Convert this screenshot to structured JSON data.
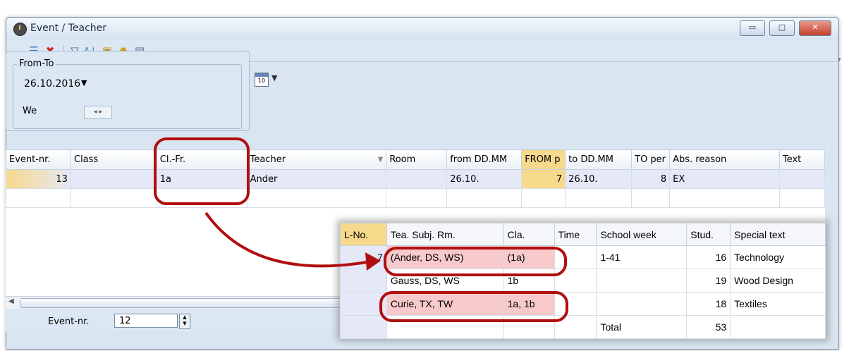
{
  "window": {
    "title": "Event / Teacher",
    "buttons": {
      "minimize": "▭",
      "maximize": "□",
      "close": "✕"
    }
  },
  "toolbar": {
    "icons": [
      "list-icon",
      "delete-icon",
      "filter-icon",
      "sort-icon",
      "settings-page-icon",
      "gear-icon",
      "clipboard-icon"
    ]
  },
  "filter": {
    "group_label": "From-To",
    "date_value": "26.10.2016",
    "weekday": "We",
    "calendar_icon_text": "10"
  },
  "grid": {
    "columns": [
      "Event-nr.",
      "Class",
      "Cl.-Fr.",
      "Teacher",
      "Room",
      "from DD.MM",
      "FROM p",
      "to DD.MM",
      "TO per",
      "Abs. reason",
      "Text"
    ],
    "row": {
      "event_nr": "13",
      "class": "",
      "cl_fr": "1a",
      "teacher": "Ander",
      "room": "",
      "from_ddmm": "26.10.",
      "from_p": "7",
      "to_ddmm": "26.10.",
      "to_per": "8",
      "abs_reason": "EX",
      "text": ""
    }
  },
  "footer": {
    "label": "Event-nr.",
    "value": "12"
  },
  "popup": {
    "columns": [
      "L-No.",
      "Tea. Subj. Rm.",
      "Cla.",
      "Time",
      "School week",
      "Stud.",
      "Special text"
    ],
    "rows": [
      {
        "lno": "7",
        "tea": "(Ander, DS, WS)",
        "cla": "(1a)",
        "time": "",
        "week": "1-41",
        "stud": "16",
        "special": "Technology"
      },
      {
        "lno": "",
        "tea": "Gauss, DS, WS",
        "cla": "1b",
        "time": "",
        "week": "",
        "stud": "19",
        "special": "Wood Design"
      },
      {
        "lno": "",
        "tea": "Curie, TX, TW",
        "cla": "1a, 1b",
        "time": "",
        "week": "",
        "stud": "18",
        "special": "Textiles"
      },
      {
        "lno": "",
        "tea": "",
        "cla": "",
        "time": "",
        "week": "Total",
        "stud": "53",
        "special": ""
      }
    ]
  },
  "colors": {
    "highlight_header": "#f7d98b",
    "selected_row": "#e5e8f7",
    "annotation_red": "#b10f0f",
    "pink_cell": "#f8c9cb"
  }
}
